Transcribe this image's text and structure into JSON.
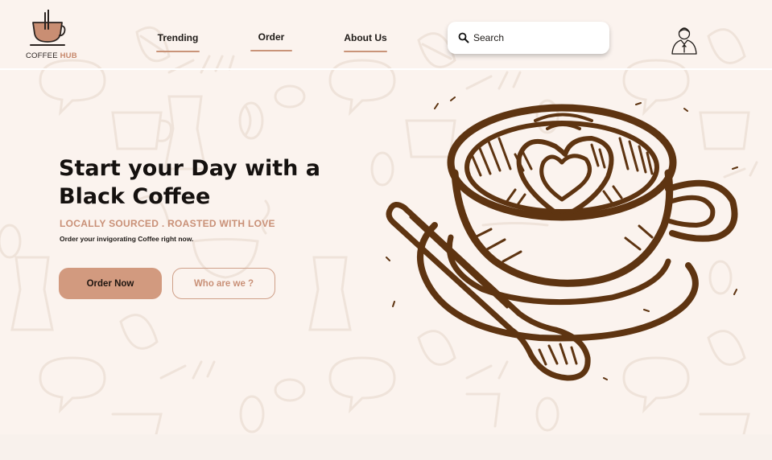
{
  "brand": {
    "logo_word1": "COFFEE",
    "logo_word2": "HUB",
    "accent_color": "#d29a7f",
    "ink_color": "#6b3e17"
  },
  "nav": {
    "items": [
      {
        "label": "Trending"
      },
      {
        "label": "Order"
      },
      {
        "label": "About Us"
      }
    ]
  },
  "search": {
    "placeholder": "Search",
    "icon": "search-icon"
  },
  "user": {
    "icon": "user-avatar-icon"
  },
  "hero": {
    "title_line1": "Start your Day with a",
    "title_line2": "Black Coffee",
    "subtitle": "LOCALLY SOURCED . ROASTED WITH LOVE",
    "description": "Order your invigorating Coffee right now.",
    "primary_button": "Order Now",
    "secondary_button": "Who are we ?"
  }
}
